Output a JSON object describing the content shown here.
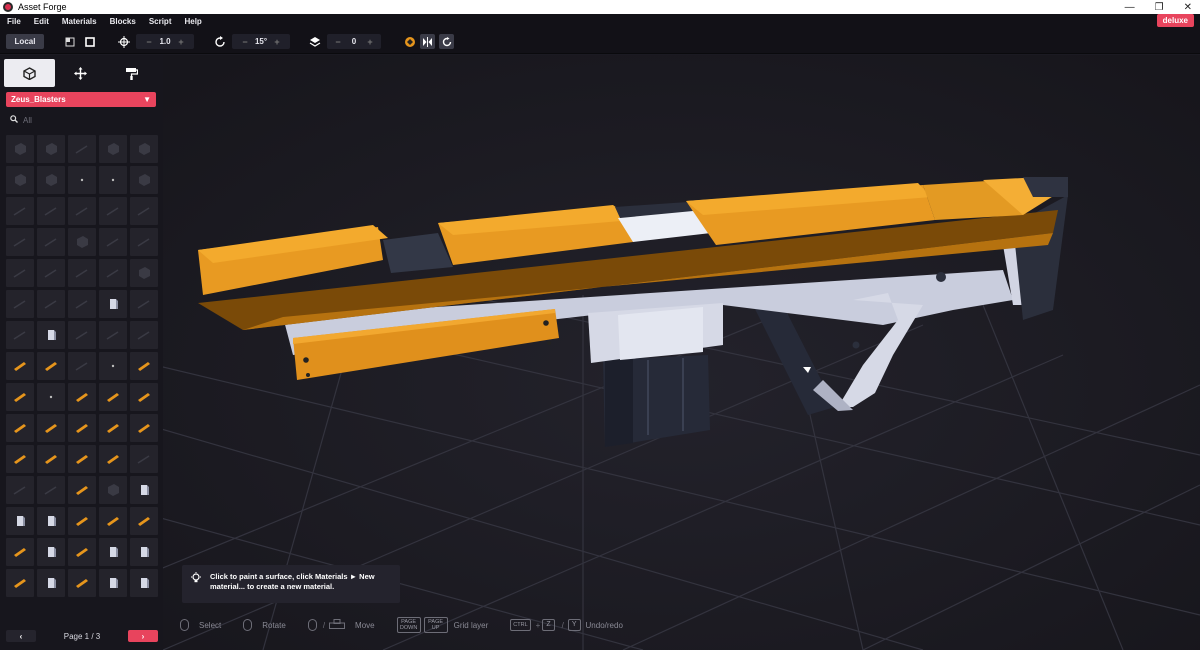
{
  "window": {
    "title": "Asset Forge",
    "min": "—",
    "max": "❐",
    "close": "✕"
  },
  "menu": [
    "File",
    "Edit",
    "Materials",
    "Blocks",
    "Script",
    "Help"
  ],
  "badge": "deluxe",
  "toolbar": {
    "local": "Local",
    "move_minus": "−",
    "move_value": "1.0",
    "move_plus": "+",
    "rot_minus": "−",
    "rot_value": "15°",
    "rot_plus": "+",
    "layer_minus": "−",
    "layer_value": "0",
    "layer_plus": "+"
  },
  "sidebar": {
    "tabs": [
      {
        "icon": "cube-icon",
        "glyph": "⬡"
      },
      {
        "icon": "move-arrows-icon",
        "glyph": "✥"
      },
      {
        "icon": "paint-roller-icon",
        "glyph": "🖌"
      }
    ],
    "category": "Zeus_Blasters",
    "search_placeholder": "All",
    "page_label": "Page 1 / 3",
    "prev": "‹",
    "next": "›"
  },
  "hint": {
    "text": "Click to paint a surface, click Materials ► New material... to create a new material."
  },
  "controls": {
    "select": "Select",
    "rotate": "Rotate",
    "slash": "/",
    "move": "Move",
    "page_down": "PAGE DOWN",
    "page_up": "PAGE UP",
    "grid_layer": "Grid layer",
    "ctrl": "CTRL",
    "plus": "+",
    "z": "Z",
    "y": "Y",
    "undo_redo": "Undo/redo"
  },
  "colors": {
    "accent": "#e8445d",
    "orange": "#e6951c",
    "white_part": "#d6d9e6",
    "dark_part": "#2a2e3c"
  }
}
